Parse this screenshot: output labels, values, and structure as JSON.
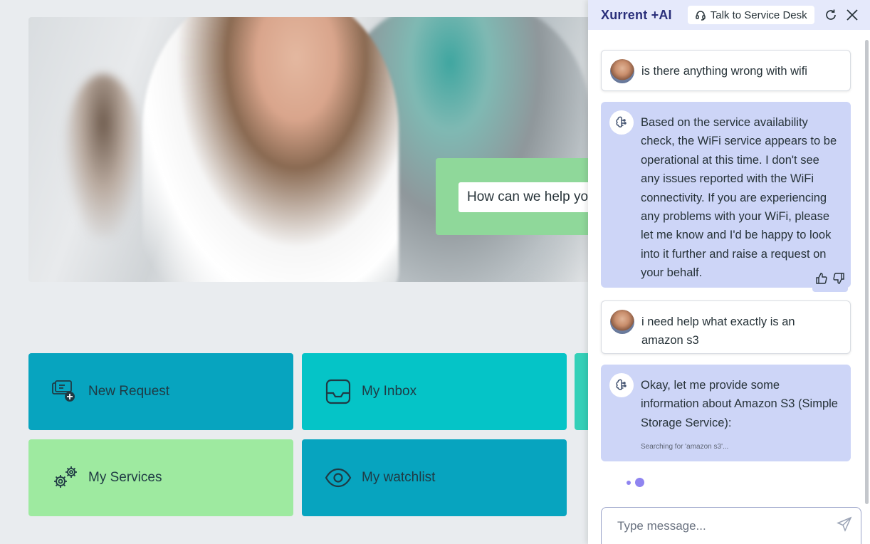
{
  "hero": {
    "search_placeholder": "How can we help you?"
  },
  "tiles": [
    {
      "label": "New Request",
      "icon": "ticket-add-icon"
    },
    {
      "label": "My Inbox",
      "icon": "inbox-icon"
    },
    {
      "label": "My Services",
      "icon": "gears-icon"
    },
    {
      "label": "My watchlist",
      "icon": "eye-icon"
    }
  ],
  "chat": {
    "brand": "Xurrent +AI",
    "service_desk_label": "Talk to Service Desk",
    "messages": [
      {
        "role": "user",
        "text": "is there anything wrong with wifi"
      },
      {
        "role": "bot",
        "text": "Based on the service availability check, the WiFi service appears to be operational at this time. I don't see any issues reported with the WiFi connectivity. If you are experiencing any problems with your WiFi, please let me know and I'd be happy to look into it further and raise a request on your behalf."
      },
      {
        "role": "user",
        "text": "i need help what exactly is an amazon s3"
      },
      {
        "role": "bot",
        "text": "Okay, let me provide some information about Amazon S3 (Simple Storage Service):",
        "status": "Searching for 'amazon s3'..."
      }
    ],
    "input_placeholder": "Type message..."
  },
  "colors": {
    "tile_blue": "#07a4bf",
    "tile_cyan": "#05c4c7",
    "tile_green": "#9eeaa0",
    "bot_bubble": "#cdd5f7",
    "header_bg": "#e5e9fb",
    "brand": "#2a2f7a"
  }
}
